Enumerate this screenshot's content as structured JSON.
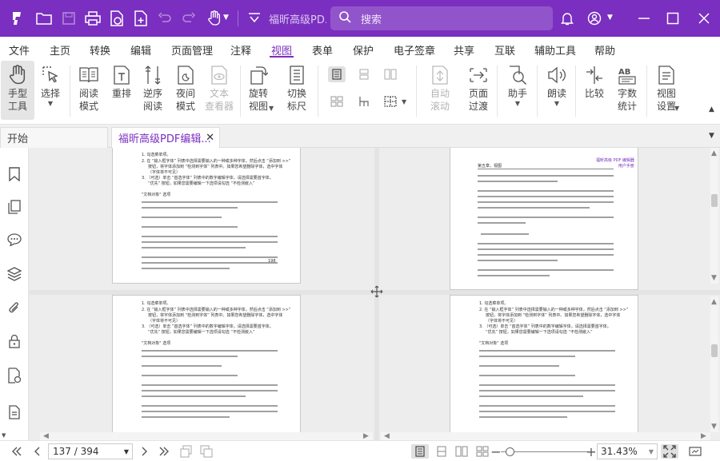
{
  "titlebar": {
    "doc_title": "福昕高级PD...",
    "search_placeholder": "搜索",
    "bg_color": "#7a2fc0",
    "icons": [
      "logo-icon",
      "open-folder-icon",
      "save-icon",
      "print-icon",
      "file-convert-icon",
      "new-file-icon",
      "undo-icon",
      "redo-icon",
      "hand-tool-icon",
      "dropdown-icon",
      "bell-icon",
      "user-icon",
      "minimize-icon",
      "maximize-icon",
      "close-icon"
    ]
  },
  "menu": {
    "items": [
      "文件",
      "主页",
      "转换",
      "编辑",
      "页面管理",
      "注释",
      "视图",
      "表单",
      "保护",
      "电子签章",
      "共享",
      "互联",
      "辅助工具",
      "帮助"
    ],
    "active": "视图"
  },
  "ribbon": {
    "hand_tool": "手型\n工具",
    "select": "选择",
    "read_mode": "阅读\n模式",
    "reflow": "重排",
    "reverse_read": "逆序\n阅读",
    "night_mode": "夜间\n模式",
    "text_viewer": "文本\n查看器",
    "rotate_view": "旋转\n视图",
    "toggle_ruler": "切换\n标尺",
    "auto_scroll": "自动\n滚动",
    "page_transition": "页面\n过渡",
    "assistant": "助手",
    "read_aloud": "朗读",
    "compare": "比较",
    "word_count": "字数\n统计",
    "view_settings": "视图\n设置"
  },
  "tabs": {
    "start": "开始",
    "doc": "福昕高级PDF编辑..."
  },
  "page_content": {
    "header_left": "第五章，视图",
    "header_right": "福昕高级 PDF 编辑器\n用户手册",
    "item_snapshot": "SnapShot",
    "bullet_lines": [
      "1. 勾选菜单项。",
      "2. 在 “输入框字体” 列表中选择需要输入的一种或多种字体，然后点击 “添加到 >>”",
      "按钮，将字体添加到 “检测到字体” 列表中。如果您希望删除字体，选中字体",
      "（字体将不可见）",
      "3. （可选）单击 “首选字体” 列表中的数字编辑字体，请选择需要首字体。",
      "“优先” 按钮，如果您需要编辑一下选项请勾选 “不检测嵌入”"
    ],
    "doc_object": "\"文档对象\" 选项",
    "footer_num": "198"
  },
  "status": {
    "page_value": "137 / 394",
    "zoom_value": "31.43%",
    "zoom_fraction": 0.1
  }
}
